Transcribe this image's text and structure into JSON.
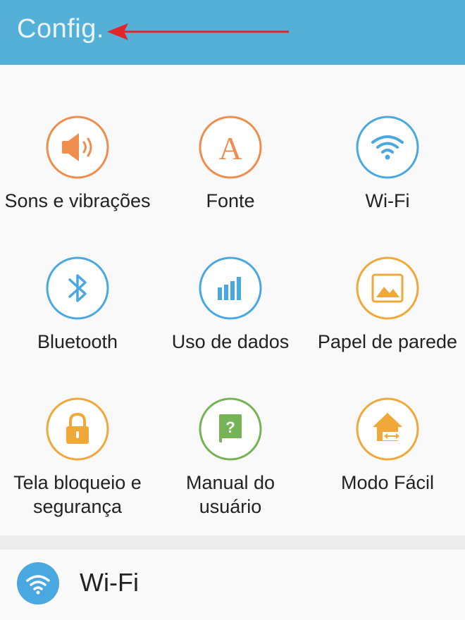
{
  "header": {
    "title": "Config."
  },
  "tiles": [
    {
      "label": "Sons e vibrações",
      "icon": "speaker-icon",
      "color": "#ee8d4e"
    },
    {
      "label": "Fonte",
      "icon": "font-icon",
      "color": "#ee8d4e"
    },
    {
      "label": "Wi-Fi",
      "icon": "wifi-icon",
      "color": "#4aa8e0"
    },
    {
      "label": "Bluetooth",
      "icon": "bluetooth-icon",
      "color": "#4aa8e0"
    },
    {
      "label": "Uso de dados",
      "icon": "data-usage-icon",
      "color": "#4aa8e0"
    },
    {
      "label": "Papel de parede",
      "icon": "wallpaper-icon",
      "color": "#f0a83a"
    },
    {
      "label": "Tela bloqueio e segurança",
      "icon": "lock-icon",
      "color": "#f0a83a"
    },
    {
      "label": "Manual do usuário",
      "icon": "manual-icon",
      "color": "#76b357"
    },
    {
      "label": "Modo Fácil",
      "icon": "easy-mode-icon",
      "color": "#f0a83a"
    }
  ],
  "list": {
    "label": "Wi-Fi",
    "icon": "wifi-icon"
  }
}
